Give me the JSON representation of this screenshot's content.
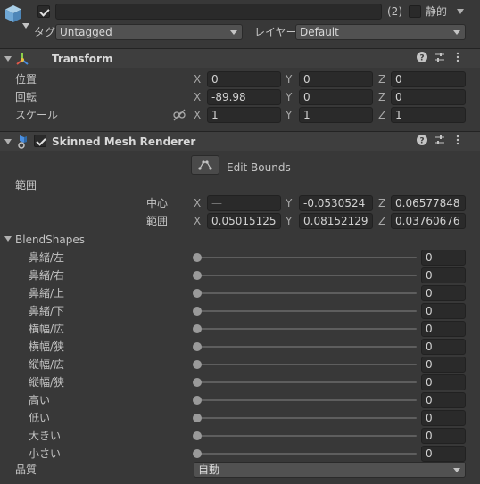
{
  "object": {
    "name": "—",
    "static_count": "(2)",
    "static_label": "静的",
    "tag_label": "タグ",
    "tag_value": "Untagged",
    "layer_label": "レイヤー",
    "layer_value": "Default"
  },
  "transform": {
    "title": "Transform",
    "position": {
      "label": "位置",
      "x": "0",
      "y": "0",
      "z": "0"
    },
    "rotation": {
      "label": "回転",
      "x": "-89.98",
      "y": "0",
      "z": "0"
    },
    "scale": {
      "label": "スケール",
      "x": "1",
      "y": "1",
      "z": "1"
    }
  },
  "renderer": {
    "title": "Skinned Mesh Renderer",
    "edit_bounds": "Edit Bounds",
    "bounds_label": "範囲",
    "center": {
      "label": "中心",
      "x": "—",
      "y": "-0.0530524",
      "z": "0.06577848"
    },
    "extent": {
      "label": "範囲",
      "x": "0.05015125",
      "y": "0.08152129",
      "z": "0.03760676"
    },
    "blendshapes_label": "BlendShapes",
    "blendshapes": [
      {
        "name": "鼻緒/左",
        "value": "0"
      },
      {
        "name": "鼻緒/右",
        "value": "0"
      },
      {
        "name": "鼻緒/上",
        "value": "0"
      },
      {
        "name": "鼻緒/下",
        "value": "0"
      },
      {
        "name": "横幅/広",
        "value": "0"
      },
      {
        "name": "横幅/狭",
        "value": "0"
      },
      {
        "name": "縦幅/広",
        "value": "0"
      },
      {
        "name": "縦幅/狭",
        "value": "0"
      },
      {
        "name": "高い",
        "value": "0"
      },
      {
        "name": "低い",
        "value": "0"
      },
      {
        "name": "大きい",
        "value": "0"
      },
      {
        "name": "小さい",
        "value": "0"
      }
    ],
    "quality_label": "品質",
    "quality_value": "自動"
  },
  "axes": {
    "x": "X",
    "y": "Y",
    "z": "Z"
  },
  "colors": {
    "background": "#383838",
    "field": "#2a2a2a",
    "header": "#3e3e3e",
    "transform_icon_red": "#e0584a",
    "transform_icon_green": "#8ccf4a",
    "transform_icon_yellow": "#e8c040",
    "renderer_icon": "#4a8ee0"
  }
}
